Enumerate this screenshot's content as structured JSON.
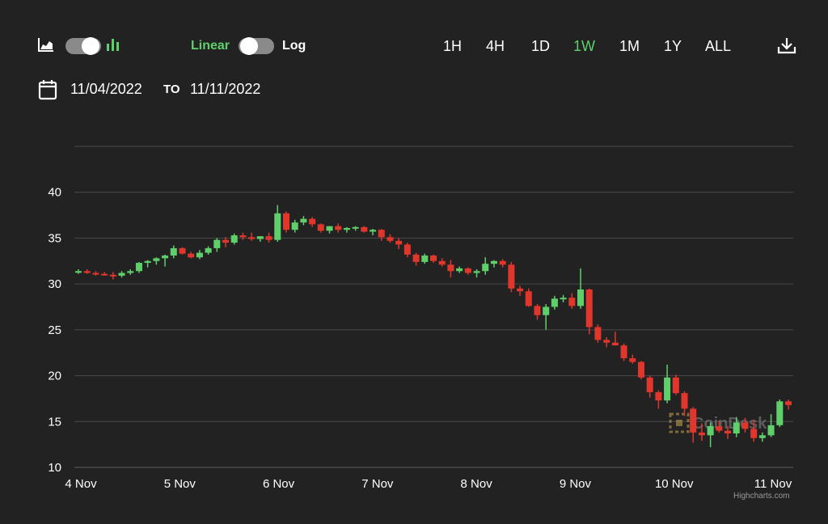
{
  "toolbar": {
    "area_chart_icon": "area-chart-icon",
    "candle_chart_icon": "bar-chart-icon",
    "scale_linear_label": "Linear",
    "scale_log_label": "Log",
    "ranges": [
      "1H",
      "4H",
      "1D",
      "1W",
      "1M",
      "1Y",
      "ALL"
    ],
    "active_range": "1W",
    "download_icon": "download-icon"
  },
  "date_range": {
    "from": "11/04/2022",
    "to_label": "TO",
    "to": "11/11/2022"
  },
  "colors": {
    "background": "#222222",
    "up": "#5fcf6b",
    "down": "#e0362c",
    "grid": "#4a4a4a",
    "accent": "#5fcf6b"
  },
  "watermark": "CoinDesk",
  "credits": "Highcharts.com",
  "chart_data": {
    "type": "candlestick",
    "x_labels": [
      "4 Nov",
      "5 Nov",
      "6 Nov",
      "7 Nov",
      "8 Nov",
      "9 Nov",
      "10 Nov",
      "11 Nov"
    ],
    "y_ticks": [
      10,
      15,
      20,
      25,
      30,
      35,
      40
    ],
    "ylim": [
      10,
      45
    ],
    "grid": true,
    "candles": [
      [
        31.3,
        31.6,
        31.1,
        31.4
      ],
      [
        31.4,
        31.6,
        31.1,
        31.2
      ],
      [
        31.2,
        31.4,
        30.9,
        31.1
      ],
      [
        31.1,
        31.3,
        30.9,
        31.0
      ],
      [
        31.0,
        31.3,
        30.5,
        30.9
      ],
      [
        30.9,
        31.4,
        30.7,
        31.2
      ],
      [
        31.2,
        31.6,
        31.0,
        31.4
      ],
      [
        31.4,
        32.4,
        31.2,
        32.3
      ],
      [
        32.3,
        32.6,
        31.8,
        32.5
      ],
      [
        32.5,
        32.9,
        32.1,
        32.8
      ],
      [
        32.8,
        33.2,
        31.9,
        33.1
      ],
      [
        33.1,
        34.2,
        32.8,
        33.9
      ],
      [
        33.9,
        34.0,
        33.2,
        33.3
      ],
      [
        33.3,
        33.5,
        32.8,
        32.9
      ],
      [
        32.9,
        33.7,
        32.7,
        33.4
      ],
      [
        33.4,
        34.1,
        33.2,
        33.9
      ],
      [
        33.9,
        35.0,
        33.5,
        34.8
      ],
      [
        34.8,
        35.1,
        34.0,
        34.5
      ],
      [
        34.5,
        35.5,
        34.3,
        35.3
      ],
      [
        35.3,
        35.6,
        34.8,
        35.1
      ],
      [
        35.1,
        35.6,
        34.7,
        34.9
      ],
      [
        34.9,
        35.2,
        34.6,
        35.2
      ],
      [
        35.2,
        35.6,
        34.5,
        34.8
      ],
      [
        34.8,
        38.6,
        34.6,
        37.7
      ],
      [
        37.7,
        37.9,
        35.6,
        35.9
      ],
      [
        35.9,
        37.0,
        35.6,
        36.7
      ],
      [
        36.7,
        37.4,
        36.4,
        37.1
      ],
      [
        37.1,
        37.3,
        36.2,
        36.5
      ],
      [
        36.5,
        36.6,
        35.6,
        35.8
      ],
      [
        35.8,
        36.3,
        35.5,
        36.3
      ],
      [
        36.3,
        36.6,
        35.6,
        35.9
      ],
      [
        35.9,
        36.2,
        35.6,
        36.1
      ],
      [
        36.1,
        36.3,
        35.8,
        36.2
      ],
      [
        36.2,
        36.3,
        35.6,
        35.7
      ],
      [
        35.7,
        36.0,
        35.3,
        35.9
      ],
      [
        35.9,
        36.0,
        34.7,
        35.1
      ],
      [
        35.1,
        35.4,
        34.5,
        34.7
      ],
      [
        34.7,
        35.0,
        33.8,
        34.3
      ],
      [
        34.3,
        34.5,
        32.9,
        33.2
      ],
      [
        33.2,
        33.4,
        32.0,
        32.4
      ],
      [
        32.4,
        33.3,
        32.2,
        33.1
      ],
      [
        33.1,
        33.2,
        32.3,
        32.5
      ],
      [
        32.5,
        32.8,
        31.9,
        32.1
      ],
      [
        32.1,
        32.6,
        30.7,
        31.4
      ],
      [
        31.4,
        31.9,
        31.2,
        31.7
      ],
      [
        31.7,
        31.8,
        31.0,
        31.2
      ],
      [
        31.2,
        31.6,
        30.7,
        31.4
      ],
      [
        31.4,
        32.9,
        31.0,
        32.2
      ],
      [
        32.2,
        32.6,
        31.8,
        32.5
      ],
      [
        32.5,
        32.7,
        31.8,
        32.1
      ],
      [
        32.1,
        32.4,
        29.1,
        29.5
      ],
      [
        29.5,
        29.8,
        28.7,
        29.2
      ],
      [
        29.2,
        29.5,
        27.5,
        27.6
      ],
      [
        27.6,
        27.8,
        26.1,
        26.6
      ],
      [
        26.6,
        27.8,
        25.0,
        27.5
      ],
      [
        27.5,
        28.7,
        27.2,
        28.4
      ],
      [
        28.4,
        28.8,
        28.0,
        28.5
      ],
      [
        28.5,
        29.0,
        27.3,
        27.6
      ],
      [
        27.6,
        31.7,
        27.3,
        29.4
      ],
      [
        29.4,
        29.5,
        24.5,
        25.3
      ],
      [
        25.3,
        25.6,
        23.6,
        23.9
      ],
      [
        23.9,
        24.2,
        23.1,
        23.6
      ],
      [
        23.6,
        24.8,
        23.3,
        23.3
      ],
      [
        23.3,
        23.5,
        21.6,
        21.9
      ],
      [
        21.9,
        22.3,
        21.3,
        21.5
      ],
      [
        21.5,
        21.6,
        19.6,
        19.8
      ],
      [
        19.8,
        20.0,
        17.6,
        18.2
      ],
      [
        18.2,
        18.4,
        16.4,
        17.3
      ],
      [
        17.3,
        21.2,
        17.0,
        19.8
      ],
      [
        19.8,
        20.1,
        17.9,
        18.1
      ],
      [
        18.1,
        18.3,
        15.6,
        16.4
      ],
      [
        16.4,
        16.6,
        12.7,
        13.8
      ],
      [
        13.8,
        14.8,
        12.9,
        13.5
      ],
      [
        13.5,
        14.9,
        12.2,
        14.5
      ],
      [
        14.5,
        15.1,
        13.8,
        14.0
      ],
      [
        14.0,
        14.5,
        13.1,
        13.7
      ],
      [
        13.7,
        15.5,
        13.3,
        14.9
      ],
      [
        14.9,
        15.4,
        13.8,
        14.2
      ],
      [
        14.2,
        15.2,
        12.8,
        13.2
      ],
      [
        13.2,
        13.8,
        12.8,
        13.5
      ],
      [
        13.5,
        15.8,
        13.3,
        14.6
      ],
      [
        14.6,
        17.4,
        14.4,
        17.2
      ],
      [
        17.2,
        17.4,
        16.3,
        16.8
      ]
    ]
  }
}
